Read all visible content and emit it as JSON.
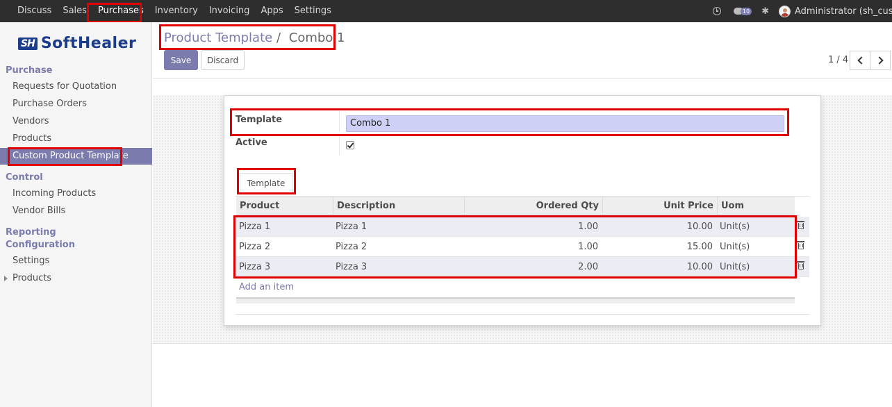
{
  "topbar": {
    "menu": [
      "Discuss",
      "Sales",
      "Purchases",
      "Inventory",
      "Invoicing",
      "Apps",
      "Settings"
    ],
    "active_menu": "Purchases",
    "notification_count": "10",
    "user": "Administrator (sh_custo..."
  },
  "logo": {
    "mark": "SH",
    "text": "SoftHealer"
  },
  "sidebar": {
    "section_purchase": "Purchase",
    "purchase_items": [
      "Requests for Quotation",
      "Purchase Orders",
      "Vendors",
      "Products",
      "Custom Product Template"
    ],
    "active_item": "Custom Product Template",
    "section_control": "Control",
    "control_items": [
      "Incoming Products",
      "Vendor Bills"
    ],
    "section_reporting": "Reporting",
    "section_configuration": "Configuration",
    "configuration_items": [
      "Settings",
      "Products"
    ]
  },
  "control_panel": {
    "breadcrumb_parent": "Product Template",
    "breadcrumb_sep": "/",
    "breadcrumb_current": "Combo 1",
    "save_label": "Save",
    "discard_label": "Discard",
    "pager": "1 / 4"
  },
  "form": {
    "template_label": "Template",
    "template_value": "Combo 1",
    "active_label": "Active",
    "active_checked": true,
    "tab_label": "Template",
    "columns": [
      "Product",
      "Description",
      "Ordered Qty",
      "Unit Price",
      "Uom"
    ],
    "rows": [
      {
        "product": "Pizza 1",
        "description": "Pizza 1",
        "qty": "1.00",
        "price": "10.00",
        "uom": "Unit(s)"
      },
      {
        "product": "Pizza 2",
        "description": "Pizza 2",
        "qty": "1.00",
        "price": "15.00",
        "uom": "Unit(s)"
      },
      {
        "product": "Pizza 3",
        "description": "Pizza 3",
        "qty": "2.00",
        "price": "10.00",
        "uom": "Unit(s)"
      }
    ],
    "add_item_label": "Add an item"
  },
  "colors": {
    "accent": "#7c7bad",
    "topbar": "#2e2e2e",
    "highlight": "#e00000",
    "selected_input": "#cfd0f5"
  }
}
